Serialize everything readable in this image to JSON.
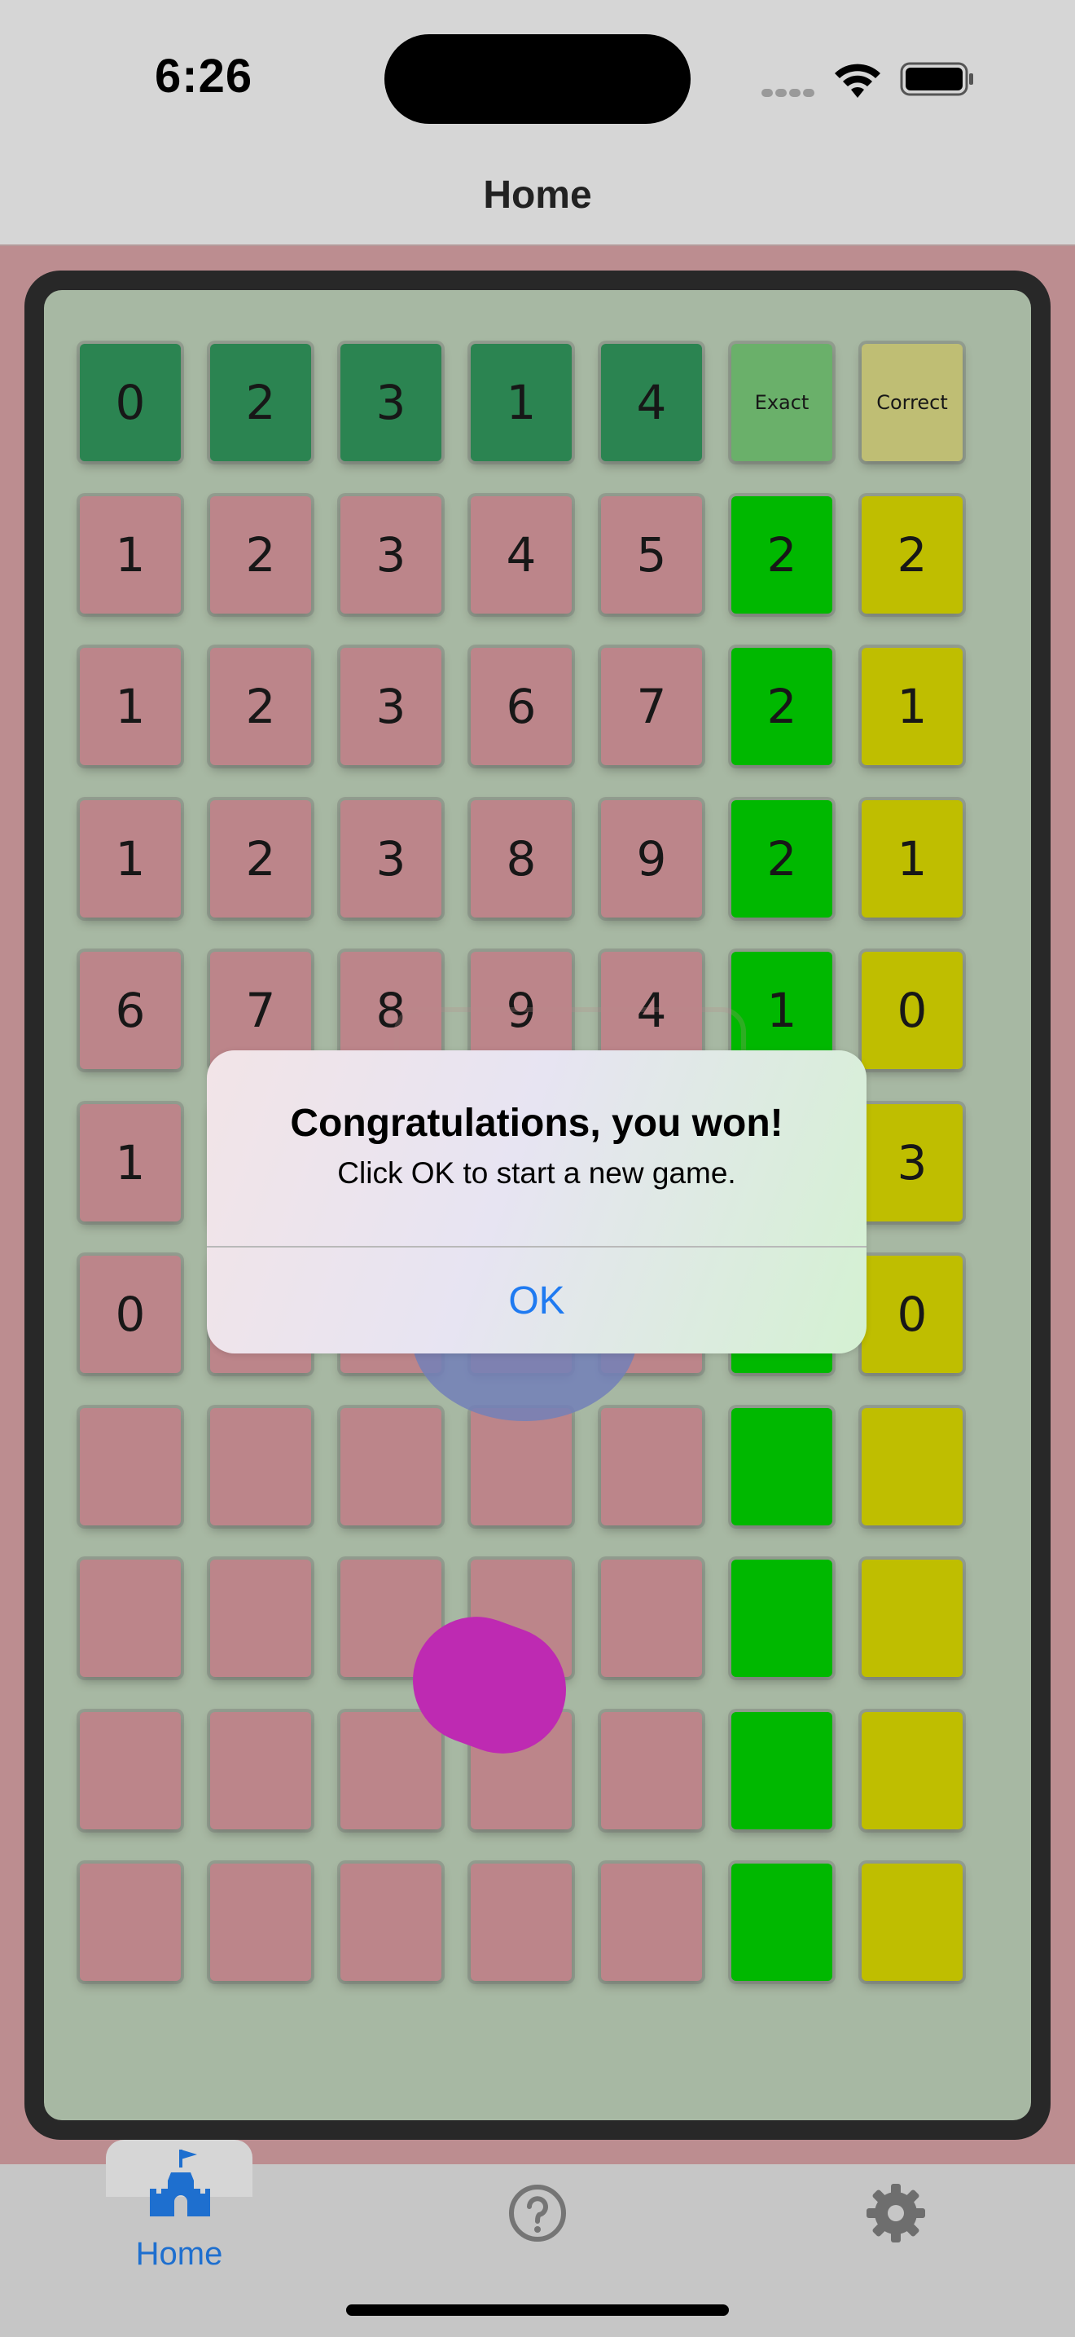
{
  "status_bar": {
    "time": "6:26"
  },
  "nav": {
    "title": "Home"
  },
  "board": {
    "header": [
      "0",
      "2",
      "3",
      "1",
      "4"
    ],
    "exact_label": "Exact",
    "correct_label": "Correct",
    "rows": [
      {
        "guess": [
          "1",
          "2",
          "3",
          "4",
          "5"
        ],
        "exact": "2",
        "correct": "2"
      },
      {
        "guess": [
          "1",
          "2",
          "3",
          "6",
          "7"
        ],
        "exact": "2",
        "correct": "1"
      },
      {
        "guess": [
          "1",
          "2",
          "3",
          "8",
          "9"
        ],
        "exact": "2",
        "correct": "1"
      },
      {
        "guess": [
          "6",
          "7",
          "8",
          "9",
          "4"
        ],
        "exact": "1",
        "correct": "0"
      },
      {
        "guess": [
          "1",
          "",
          "",
          "",
          ""
        ],
        "exact": "",
        "correct": "3"
      },
      {
        "guess": [
          "0",
          "",
          "",
          "",
          ""
        ],
        "exact": "",
        "correct": "0"
      },
      {
        "guess": [
          "",
          "",
          "",
          "",
          ""
        ],
        "exact": "",
        "correct": ""
      },
      {
        "guess": [
          "",
          "",
          "",
          "",
          ""
        ],
        "exact": "",
        "correct": ""
      },
      {
        "guess": [
          "",
          "",
          "",
          "",
          ""
        ],
        "exact": "",
        "correct": ""
      },
      {
        "guess": [
          "",
          "",
          "",
          "",
          ""
        ],
        "exact": "",
        "correct": ""
      }
    ]
  },
  "alert": {
    "title": "Congratulations, you won!",
    "message": "Click OK to start a new game.",
    "ok_label": "OK"
  },
  "tabs": {
    "home_label": "Home",
    "home_icon": "castle-icon",
    "help_icon": "question-circle-icon",
    "settings_icon": "gear-icon"
  },
  "colors": {
    "header_digit": "#2f9058",
    "exact": "#00c800",
    "correct": "#d0cf00",
    "guess": "#cc9196",
    "accent": "#1f7af1"
  }
}
